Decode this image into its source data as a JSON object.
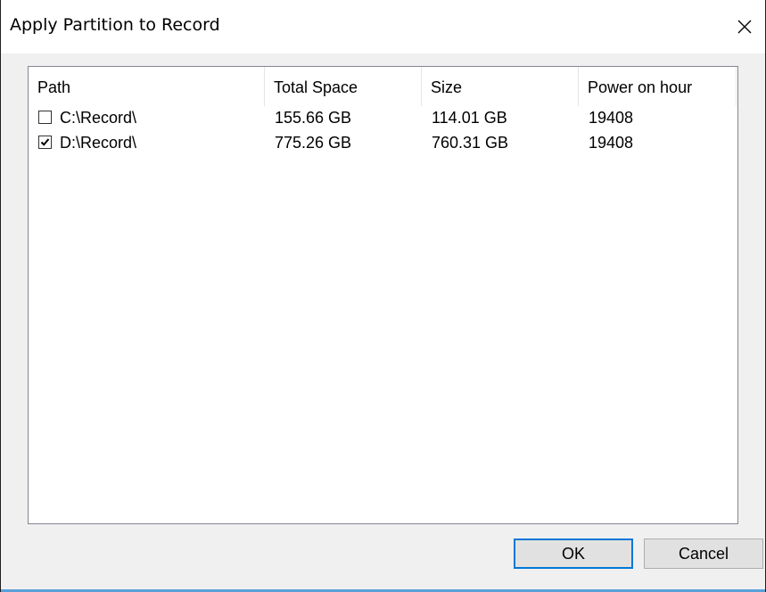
{
  "window": {
    "title": "Apply Partition to Record"
  },
  "icons": {
    "close": "close-icon",
    "check": "checkmark-icon"
  },
  "colors": {
    "default_button_border": "#0078d7",
    "list_border": "#828790",
    "window_background": "#f0f0f0"
  },
  "list": {
    "columns": [
      "Path",
      "Total Space",
      "Size",
      "Power on hour"
    ],
    "rows": [
      {
        "checked": false,
        "path": "C:\\Record\\",
        "total_space": "155.66 GB",
        "size": "114.01 GB",
        "power_on_hour": "19408"
      },
      {
        "checked": true,
        "path": "D:\\Record\\",
        "total_space": "775.26 GB",
        "size": "760.31 GB",
        "power_on_hour": "19408"
      }
    ]
  },
  "buttons": {
    "ok_label": "OK",
    "cancel_label": "Cancel"
  }
}
